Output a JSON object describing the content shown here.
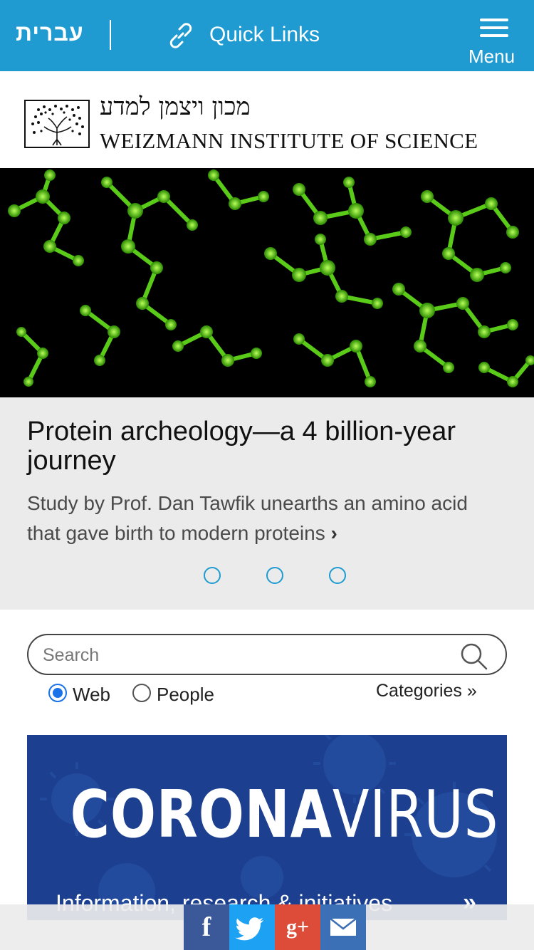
{
  "topbar": {
    "language_label": "עברית",
    "quick_links_label": "Quick Links",
    "menu_label": "Menu",
    "background": "#1f9bd1",
    "icons": {
      "quick_links": "link-icon",
      "menu": "hamburger-icon"
    }
  },
  "logo": {
    "hebrew": "מכון ויצמן למדע",
    "english": "WEIZMANN INSTITUTE OF SCIENCE",
    "icon": "tree-logo-icon"
  },
  "hero": {
    "image": "green-molecular-structures"
  },
  "story": {
    "title": "Protein archeology—a 4 billion-year journey",
    "subtitle": "Study by Prof. Dan Tawfik unearths an amino acid that gave birth to modern proteins",
    "chevron": "›",
    "carousel_dots": 3,
    "background": "#ebebeb"
  },
  "search": {
    "placeholder": "Search",
    "value": "",
    "options": [
      {
        "label": "Web",
        "selected": true
      },
      {
        "label": "People",
        "selected": false
      }
    ],
    "categories_label": "Categories »"
  },
  "banner": {
    "title_bold": "CORONA",
    "title_light": "VIRUS",
    "subtitle": "Information, research & initiatives",
    "chevron": "»",
    "background": "#1c3f8f"
  },
  "share": {
    "buttons": [
      {
        "name": "facebook",
        "glyph": "f",
        "color": "#3b5998"
      },
      {
        "name": "twitter",
        "glyph": "twitter-bird-icon",
        "color": "#1da1f2"
      },
      {
        "name": "google-plus",
        "glyph": "g+",
        "color": "#dd4b39"
      },
      {
        "name": "email",
        "glyph": "envelope-icon",
        "color": "#3b6fb6"
      }
    ]
  }
}
